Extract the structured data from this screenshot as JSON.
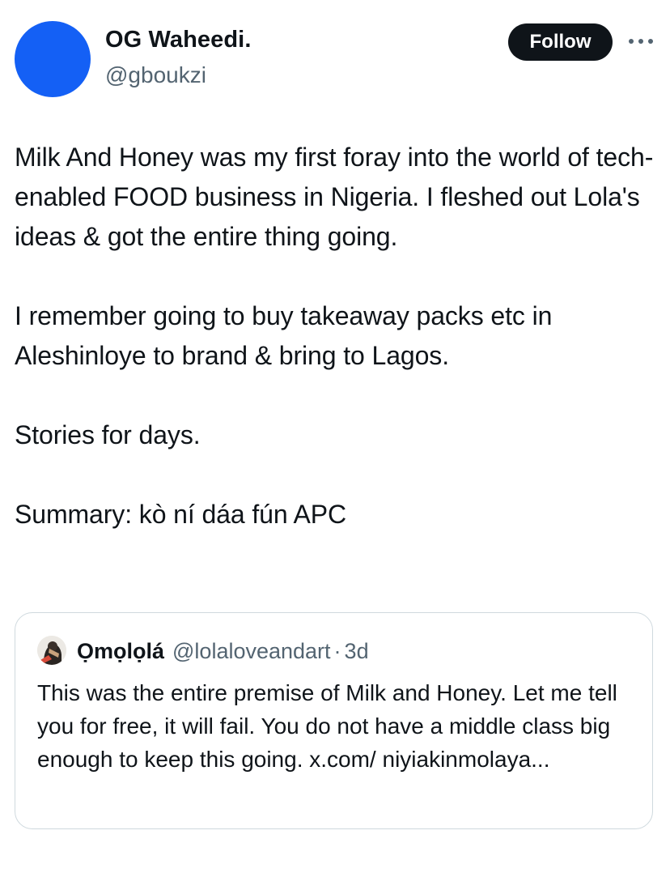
{
  "author": {
    "display_name": "OG Waheedi.",
    "handle": "@gboukzi",
    "avatar_color": "#1460f5"
  },
  "actions": {
    "follow_label": "Follow",
    "more_icon": "more-horizontal-icon"
  },
  "tweet": {
    "paragraphs": [
      "Milk And Honey was my first foray into the world of tech-enabled FOOD business in Nigeria. I fleshed out Lola's ideas & got the entire thing going.",
      "I remember going to buy takeaway packs etc in Aleshinloye to brand & bring to Lagos.",
      "Stories for days.",
      "Summary: kò ní dáa fún APC"
    ]
  },
  "quote": {
    "display_name": "Ọmọlọlá",
    "handle": "@lolaloveandart",
    "separator": "·",
    "time": "3d",
    "text": "This was the entire premise of Milk and Honey. Let me tell you for free, it will fail. You do not have a middle class big enough to keep this going. x.com/ niyiakinmolaya..."
  },
  "colors": {
    "text_primary": "#0f1419",
    "text_secondary": "#536471",
    "border": "#cfd9de",
    "follow_bg": "#0f1419"
  }
}
